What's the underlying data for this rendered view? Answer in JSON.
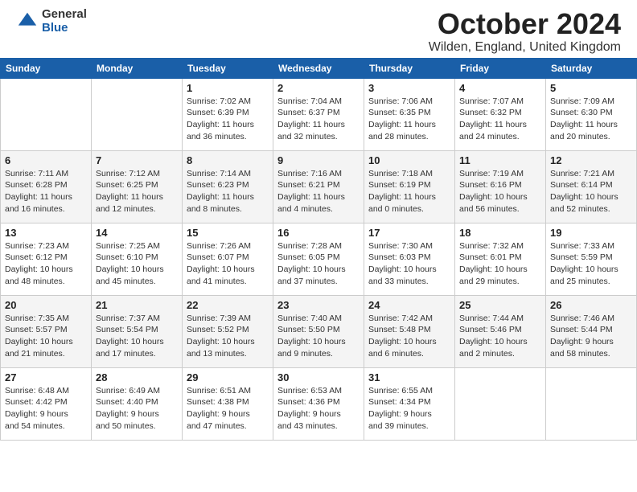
{
  "header": {
    "logo_general": "General",
    "logo_blue": "Blue",
    "month_title": "October 2024",
    "location": "Wilden, England, United Kingdom"
  },
  "days_of_week": [
    "Sunday",
    "Monday",
    "Tuesday",
    "Wednesday",
    "Thursday",
    "Friday",
    "Saturday"
  ],
  "weeks": [
    [
      {
        "day": "",
        "info": ""
      },
      {
        "day": "",
        "info": ""
      },
      {
        "day": "1",
        "info": "Sunrise: 7:02 AM\nSunset: 6:39 PM\nDaylight: 11 hours\nand 36 minutes."
      },
      {
        "day": "2",
        "info": "Sunrise: 7:04 AM\nSunset: 6:37 PM\nDaylight: 11 hours\nand 32 minutes."
      },
      {
        "day": "3",
        "info": "Sunrise: 7:06 AM\nSunset: 6:35 PM\nDaylight: 11 hours\nand 28 minutes."
      },
      {
        "day": "4",
        "info": "Sunrise: 7:07 AM\nSunset: 6:32 PM\nDaylight: 11 hours\nand 24 minutes."
      },
      {
        "day": "5",
        "info": "Sunrise: 7:09 AM\nSunset: 6:30 PM\nDaylight: 11 hours\nand 20 minutes."
      }
    ],
    [
      {
        "day": "6",
        "info": "Sunrise: 7:11 AM\nSunset: 6:28 PM\nDaylight: 11 hours\nand 16 minutes."
      },
      {
        "day": "7",
        "info": "Sunrise: 7:12 AM\nSunset: 6:25 PM\nDaylight: 11 hours\nand 12 minutes."
      },
      {
        "day": "8",
        "info": "Sunrise: 7:14 AM\nSunset: 6:23 PM\nDaylight: 11 hours\nand 8 minutes."
      },
      {
        "day": "9",
        "info": "Sunrise: 7:16 AM\nSunset: 6:21 PM\nDaylight: 11 hours\nand 4 minutes."
      },
      {
        "day": "10",
        "info": "Sunrise: 7:18 AM\nSunset: 6:19 PM\nDaylight: 11 hours\nand 0 minutes."
      },
      {
        "day": "11",
        "info": "Sunrise: 7:19 AM\nSunset: 6:16 PM\nDaylight: 10 hours\nand 56 minutes."
      },
      {
        "day": "12",
        "info": "Sunrise: 7:21 AM\nSunset: 6:14 PM\nDaylight: 10 hours\nand 52 minutes."
      }
    ],
    [
      {
        "day": "13",
        "info": "Sunrise: 7:23 AM\nSunset: 6:12 PM\nDaylight: 10 hours\nand 48 minutes."
      },
      {
        "day": "14",
        "info": "Sunrise: 7:25 AM\nSunset: 6:10 PM\nDaylight: 10 hours\nand 45 minutes."
      },
      {
        "day": "15",
        "info": "Sunrise: 7:26 AM\nSunset: 6:07 PM\nDaylight: 10 hours\nand 41 minutes."
      },
      {
        "day": "16",
        "info": "Sunrise: 7:28 AM\nSunset: 6:05 PM\nDaylight: 10 hours\nand 37 minutes."
      },
      {
        "day": "17",
        "info": "Sunrise: 7:30 AM\nSunset: 6:03 PM\nDaylight: 10 hours\nand 33 minutes."
      },
      {
        "day": "18",
        "info": "Sunrise: 7:32 AM\nSunset: 6:01 PM\nDaylight: 10 hours\nand 29 minutes."
      },
      {
        "day": "19",
        "info": "Sunrise: 7:33 AM\nSunset: 5:59 PM\nDaylight: 10 hours\nand 25 minutes."
      }
    ],
    [
      {
        "day": "20",
        "info": "Sunrise: 7:35 AM\nSunset: 5:57 PM\nDaylight: 10 hours\nand 21 minutes."
      },
      {
        "day": "21",
        "info": "Sunrise: 7:37 AM\nSunset: 5:54 PM\nDaylight: 10 hours\nand 17 minutes."
      },
      {
        "day": "22",
        "info": "Sunrise: 7:39 AM\nSunset: 5:52 PM\nDaylight: 10 hours\nand 13 minutes."
      },
      {
        "day": "23",
        "info": "Sunrise: 7:40 AM\nSunset: 5:50 PM\nDaylight: 10 hours\nand 9 minutes."
      },
      {
        "day": "24",
        "info": "Sunrise: 7:42 AM\nSunset: 5:48 PM\nDaylight: 10 hours\nand 6 minutes."
      },
      {
        "day": "25",
        "info": "Sunrise: 7:44 AM\nSunset: 5:46 PM\nDaylight: 10 hours\nand 2 minutes."
      },
      {
        "day": "26",
        "info": "Sunrise: 7:46 AM\nSunset: 5:44 PM\nDaylight: 9 hours\nand 58 minutes."
      }
    ],
    [
      {
        "day": "27",
        "info": "Sunrise: 6:48 AM\nSunset: 4:42 PM\nDaylight: 9 hours\nand 54 minutes."
      },
      {
        "day": "28",
        "info": "Sunrise: 6:49 AM\nSunset: 4:40 PM\nDaylight: 9 hours\nand 50 minutes."
      },
      {
        "day": "29",
        "info": "Sunrise: 6:51 AM\nSunset: 4:38 PM\nDaylight: 9 hours\nand 47 minutes."
      },
      {
        "day": "30",
        "info": "Sunrise: 6:53 AM\nSunset: 4:36 PM\nDaylight: 9 hours\nand 43 minutes."
      },
      {
        "day": "31",
        "info": "Sunrise: 6:55 AM\nSunset: 4:34 PM\nDaylight: 9 hours\nand 39 minutes."
      },
      {
        "day": "",
        "info": ""
      },
      {
        "day": "",
        "info": ""
      }
    ]
  ]
}
